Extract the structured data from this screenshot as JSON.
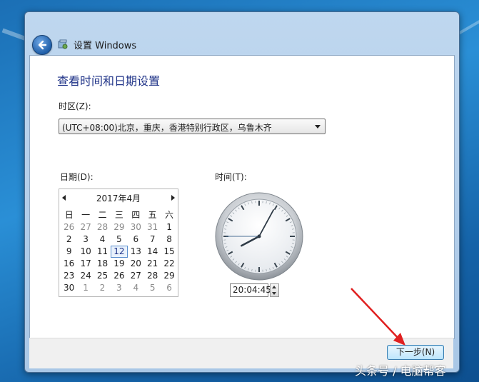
{
  "window": {
    "title": "设置 Windows"
  },
  "main": {
    "heading": "查看时间和日期设置",
    "timezone_label": "时区(Z):",
    "timezone_value": "(UTC+08:00)北京，重庆，香港特别行政区，乌鲁木齐",
    "date_label": "日期(D):",
    "time_label": "时间(T):"
  },
  "calendar": {
    "month_title": "2017年4月",
    "weekdays": [
      "日",
      "一",
      "二",
      "三",
      "四",
      "五",
      "六"
    ],
    "weeks": [
      [
        "26",
        "27",
        "28",
        "29",
        "30",
        "31",
        "1"
      ],
      [
        "2",
        "3",
        "4",
        "5",
        "6",
        "7",
        "8"
      ],
      [
        "9",
        "10",
        "11",
        "12",
        "13",
        "14",
        "15"
      ],
      [
        "16",
        "17",
        "18",
        "19",
        "20",
        "21",
        "22"
      ],
      [
        "23",
        "24",
        "25",
        "26",
        "27",
        "28",
        "29"
      ],
      [
        "30",
        "1",
        "2",
        "3",
        "4",
        "5",
        "6"
      ]
    ],
    "selected_day": "12"
  },
  "clock": {
    "time_value": "20:04:45",
    "hours": 20,
    "minutes": 4,
    "seconds": 45
  },
  "footer": {
    "next_label": "下一步(N)"
  },
  "watermark": "头条号 / 电脑帮客",
  "colors": {
    "heading": "#1e3287",
    "annotation_arrow": "#e02020"
  },
  "icons": {
    "back": "back-arrow-icon",
    "window": "windows-setup-icon"
  }
}
